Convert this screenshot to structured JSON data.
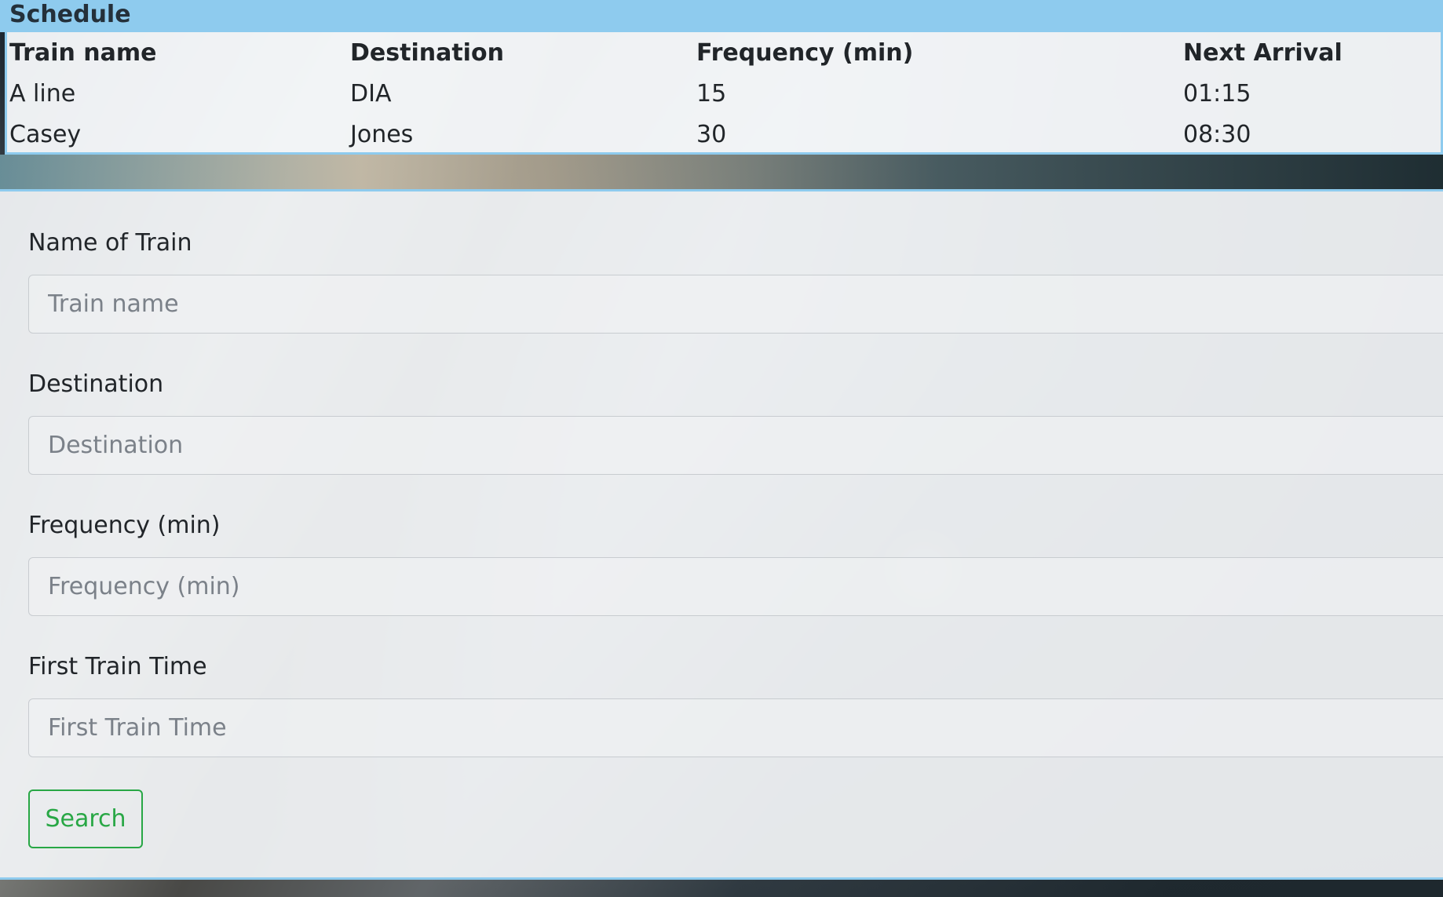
{
  "schedule": {
    "title": "Schedule",
    "columns": [
      "Train name",
      "Destination",
      "Frequency (min)",
      "Next Arrival"
    ],
    "rows": [
      [
        "A line",
        "DIA",
        "15",
        "01:15"
      ],
      [
        "Casey",
        "Jones",
        "30",
        "08:30"
      ]
    ]
  },
  "form": {
    "fields": [
      {
        "label": "Name of Train",
        "placeholder": "Train name",
        "value": ""
      },
      {
        "label": "Destination",
        "placeholder": "Destination",
        "value": ""
      },
      {
        "label": "Frequency (min)",
        "placeholder": "Frequency (min)",
        "value": ""
      },
      {
        "label": "First Train Time",
        "placeholder": "First Train Time",
        "value": ""
      }
    ],
    "submit_label": "Search"
  },
  "colors": {
    "header_bg": "#8ecbee",
    "button_accent": "#28a745",
    "text": "#212529"
  }
}
